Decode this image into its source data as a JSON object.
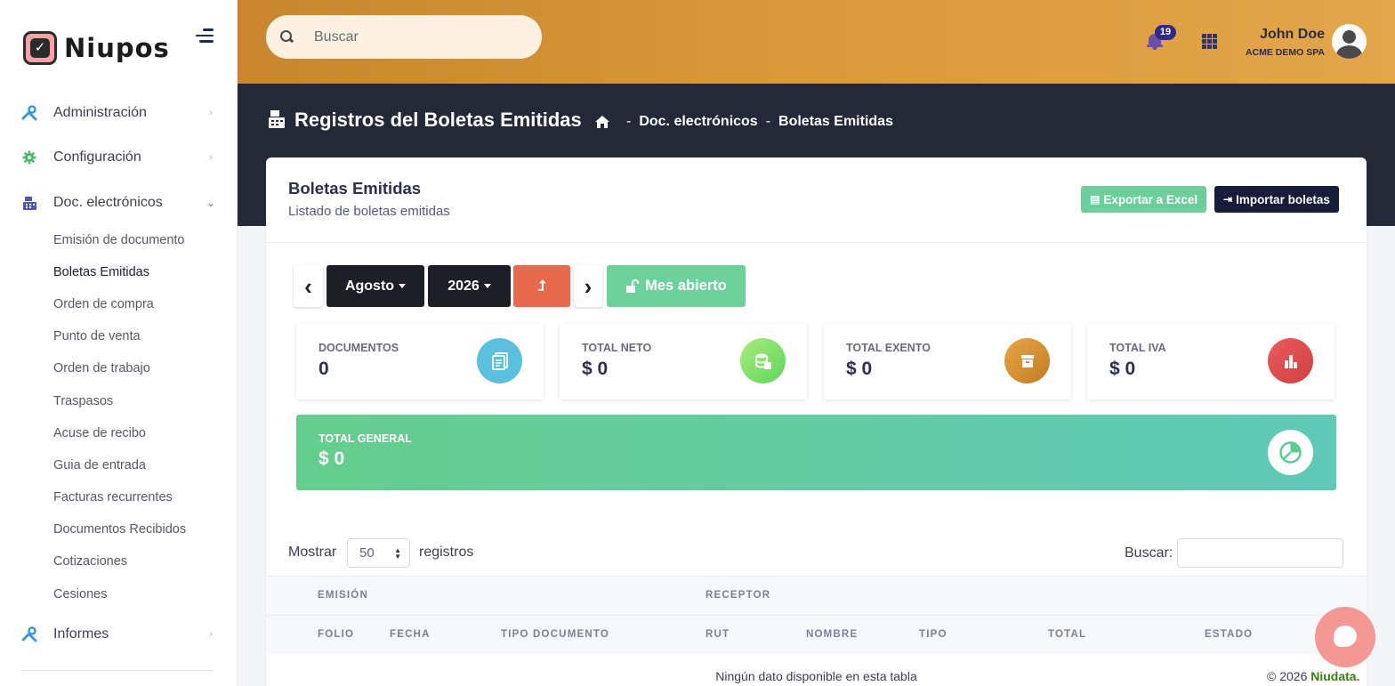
{
  "brand": {
    "name": "Niupos"
  },
  "sidebar": {
    "items": [
      {
        "label": "Administración",
        "icon": "tools-icon"
      },
      {
        "label": "Configuración",
        "icon": "gear-icon"
      },
      {
        "label": "Doc. electrónicos",
        "icon": "cash-register-icon"
      },
      {
        "label": "Informes",
        "icon": "tools-icon"
      }
    ],
    "subitems": [
      "Emisión de documento",
      "Boletas Emitidas",
      "Orden de compra",
      "Punto de venta",
      "Orden de trabajo",
      "Traspasos",
      "Acuse de recibo",
      "Guia de entrada",
      "Facturas recurrentes",
      "Documentos Recibidos",
      "Cotizaciones",
      "Cesiones"
    ]
  },
  "header": {
    "search_placeholder": "Buscar",
    "notifications_count": "19",
    "user_name": "John Doe",
    "user_company": "ACME DEMO SPA"
  },
  "page": {
    "title": "Registros del Boletas Emitidas",
    "breadcrumb": [
      "Doc. electrónicos",
      "Boletas Emitidas"
    ],
    "breadcrumb_sep": "-"
  },
  "card": {
    "title": "Boletas Emitidas",
    "subtitle": "Listado de boletas emitidas",
    "export_label": "Exportar a Excel",
    "import_label": "Importar boletas"
  },
  "period": {
    "prev": "‹",
    "next": "›",
    "month": "Agosto",
    "year": "2026",
    "upload_glyph": "⮥",
    "status": "Mes abierto"
  },
  "stats": [
    {
      "label": "DOCUMENTOS",
      "value": "0",
      "color": "#5bc0de",
      "icon": "documents-icon"
    },
    {
      "label": "TOTAL NETO",
      "value": "$ 0",
      "color": "#7ddc5c",
      "icon": "database-icon"
    },
    {
      "label": "TOTAL EXENTO",
      "value": "$ 0",
      "color": "#d58c2e",
      "icon": "archive-icon"
    },
    {
      "label": "TOTAL IVA",
      "value": "$ 0",
      "color": "#e14b4b",
      "icon": "bar-chart-icon"
    }
  ],
  "total_general": {
    "label": "TOTAL GENERAL",
    "value": "$ 0",
    "icon": "pie-chart-icon"
  },
  "table": {
    "length_prefix": "Mostrar",
    "length_value": "50",
    "length_suffix": "registros",
    "filter_label": "Buscar:",
    "group_headers": [
      "EMISIÓN",
      "RECEPTOR"
    ],
    "columns": [
      "FOLIO",
      "FECHA",
      "TIPO DOCUMENTO",
      "RUT",
      "NOMBRE",
      "TIPO",
      "TOTAL",
      "ESTADO"
    ],
    "empty_message": "Ningún dato disponible en esta tabla"
  },
  "footer": {
    "copyright": "© 2026",
    "brand": "Niudata."
  }
}
